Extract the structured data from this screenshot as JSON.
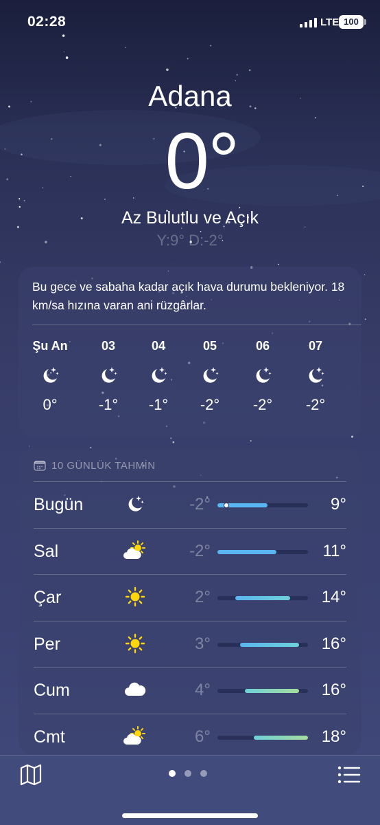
{
  "status_bar": {
    "time": "02:28",
    "network": "LTE",
    "battery": "100"
  },
  "current": {
    "city": "Adana",
    "temperature": "0°",
    "condition": "Az Bulutlu ve Açık",
    "high_low": "Y:9° D:-2°"
  },
  "hourly": {
    "summary": "Bu gece ve sabaha kadar açık hava durumu bekleniyor. 18 km/sa hızına varan ani rüzgârlar.",
    "items": [
      {
        "label": "Şu An",
        "icon": "moon-stars-icon",
        "temp": "0°"
      },
      {
        "label": "03",
        "icon": "moon-stars-icon",
        "temp": "-1°"
      },
      {
        "label": "04",
        "icon": "moon-stars-icon",
        "temp": "-1°"
      },
      {
        "label": "05",
        "icon": "moon-stars-icon",
        "temp": "-2°"
      },
      {
        "label": "06",
        "icon": "moon-stars-icon",
        "temp": "-2°"
      },
      {
        "label": "07",
        "icon": "moon-stars-icon",
        "temp": "-2°"
      }
    ]
  },
  "daily": {
    "header": "10 GÜNLÜK TAHMİN",
    "range_min": -2,
    "range_max": 18,
    "days": [
      {
        "name": "Bugün",
        "icon": "moon-stars-icon",
        "low": "-2°",
        "high": "9°",
        "low_val": -2,
        "high_val": 9,
        "current_val": 0
      },
      {
        "name": "Sal",
        "icon": "sun-cloud-icon",
        "low": "-2°",
        "high": "11°",
        "low_val": -2,
        "high_val": 11
      },
      {
        "name": "Çar",
        "icon": "sun-icon",
        "low": "2°",
        "high": "14°",
        "low_val": 2,
        "high_val": 14
      },
      {
        "name": "Per",
        "icon": "sun-icon",
        "low": "3°",
        "high": "16°",
        "low_val": 3,
        "high_val": 16
      },
      {
        "name": "Cum",
        "icon": "cloud-icon",
        "low": "4°",
        "high": "16°",
        "low_val": 4,
        "high_val": 16
      },
      {
        "name": "Cmt",
        "icon": "sun-cloud-icon",
        "low": "6°",
        "high": "18°",
        "low_val": 6,
        "high_val": 18
      }
    ]
  },
  "colors": {
    "bar_cold": "#5ab6f0",
    "bar_mild": "#6fd0d8",
    "bar_warm": "#a6dc9e",
    "sun": "#ffd60a"
  },
  "toolbar": {
    "map_icon": "map-icon",
    "list_icon": "list-icon",
    "pages": 3,
    "active_page": 0
  }
}
